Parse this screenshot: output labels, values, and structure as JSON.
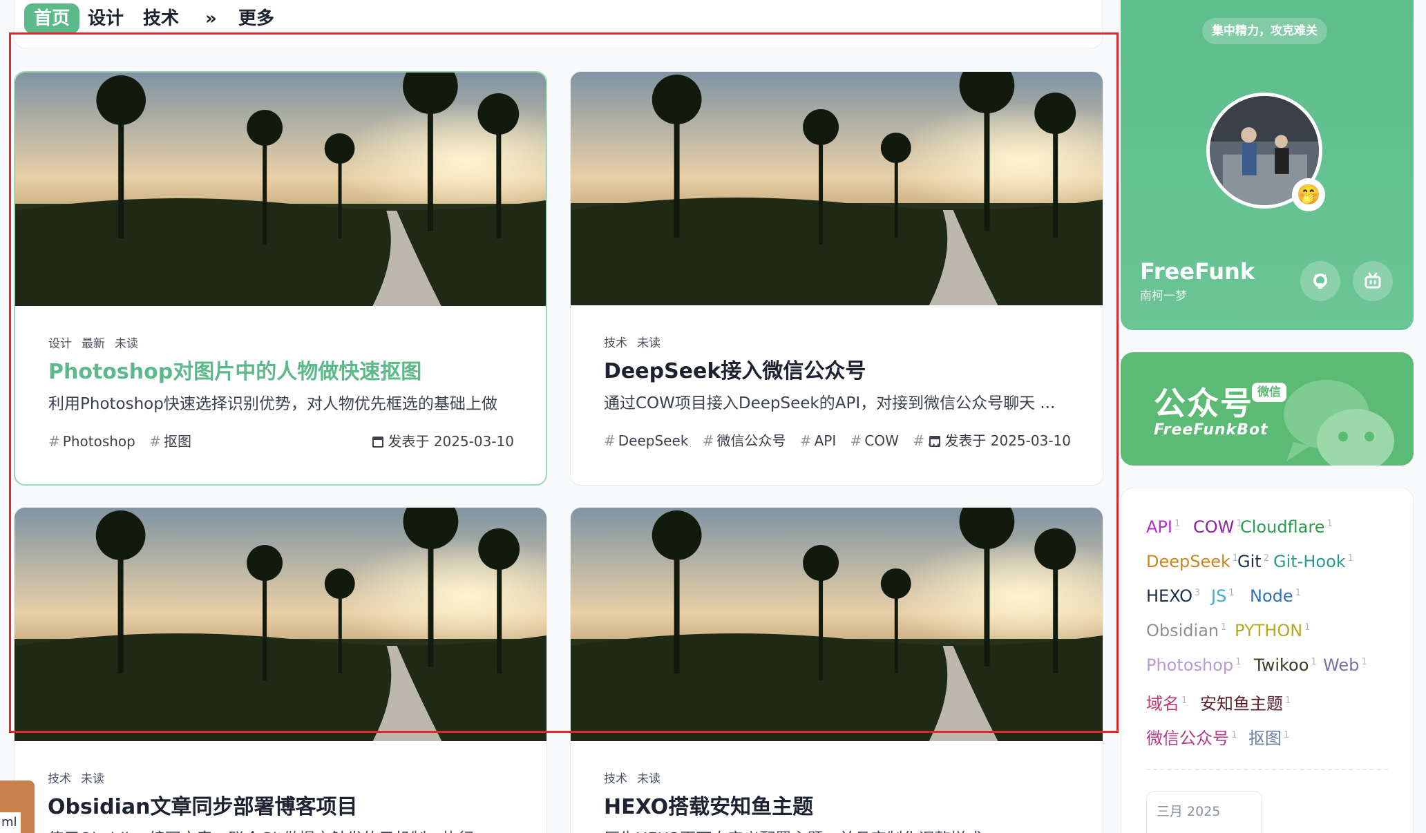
{
  "nav": {
    "items": [
      "首页",
      "设计",
      "技术",
      "»",
      "更多"
    ]
  },
  "posts": [
    {
      "meta": [
        "设计",
        "最新",
        "未读"
      ],
      "title": "Photoshop对图片中的人物做快速抠图",
      "excerpt": "利用Photoshop快速选择识别优势，对人物优先框选的基础上做",
      "tags": [
        "Photoshop",
        "抠图"
      ],
      "date": "发表于 2025-03-10"
    },
    {
      "meta": [
        "技术",
        "未读"
      ],
      "title": "DeepSeek接入微信公众号",
      "excerpt": "通过COW项目接入DeepSeek的API，对接到微信公众号聊天 ...",
      "tags": [
        "DeepSeek",
        "微信公众号",
        "API",
        "COW",
        "..."
      ],
      "date": "发表于 2025-03-10"
    },
    {
      "meta": [
        "技术",
        "未读"
      ],
      "title": "Obsidian文章同步部署博客项目",
      "excerpt": "使用Obsidian编写文章，联合Git做提交触发的子机制，执行",
      "tags": [],
      "date": ""
    },
    {
      "meta": [
        "技术",
        "未读"
      ],
      "title": "HEXO搭载安知鱼主题",
      "excerpt": "原生HEXO页面自定义配置主题，并且定制化调整样式",
      "tags": [],
      "date": ""
    }
  ],
  "profile": {
    "motto": "集中精力，攻克难关",
    "name": "FreeFunk",
    "subtitle": "南柯一梦",
    "badge_emoji": "🤭",
    "icons": [
      "github-icon",
      "bilibili-icon"
    ]
  },
  "wechat": {
    "title": "公众号",
    "badge": "微信",
    "account": "FreeFunkBot"
  },
  "tag_cloud": [
    {
      "name": "API",
      "count": "1",
      "color": "#b12fc9"
    },
    {
      "name": "COW",
      "count": "1",
      "color": "#8a1f9f"
    },
    {
      "name": "Cloudflare",
      "count": "1",
      "color": "#2a9d4f"
    },
    {
      "name": "DeepSeek",
      "count": "1",
      "color": "#c9861f"
    },
    {
      "name": "Git",
      "count": "2",
      "color": "#1d2b4a"
    },
    {
      "name": "Git-Hook",
      "count": "1",
      "color": "#2a9a8a"
    },
    {
      "name": "HEXO",
      "count": "3",
      "color": "#1d2b4a"
    },
    {
      "name": "JS",
      "count": "1",
      "color": "#3fa6d6"
    },
    {
      "name": "Node",
      "count": "1",
      "color": "#2f6fbd"
    },
    {
      "name": "Obsidian",
      "count": "1",
      "color": "#8a909c"
    },
    {
      "name": "PYTHON",
      "count": "1",
      "color": "#b6a81f"
    },
    {
      "name": "Photoshop",
      "count": "1",
      "color": "#b89ad6"
    },
    {
      "name": "Twikoo",
      "count": "1",
      "color": "#3a3a1f"
    },
    {
      "name": "Web",
      "count": "1",
      "color": "#7a6fa6"
    },
    {
      "name": "域名",
      "count": "1",
      "color": "#c43a6a"
    },
    {
      "name": "安知鱼主题",
      "count": "1",
      "color": "#5a1f2a"
    },
    {
      "name": "微信公众号",
      "count": "1",
      "color": "#b23a8a"
    },
    {
      "name": "抠图",
      "count": "1",
      "color": "#6a7fa6"
    }
  ],
  "archive": {
    "label": "三月 2025"
  },
  "edge_tab": {
    "label": "ml"
  },
  "colors": {
    "accent": "#5bb98a",
    "wechat": "#5bbb74",
    "selection": "#e0262a"
  }
}
